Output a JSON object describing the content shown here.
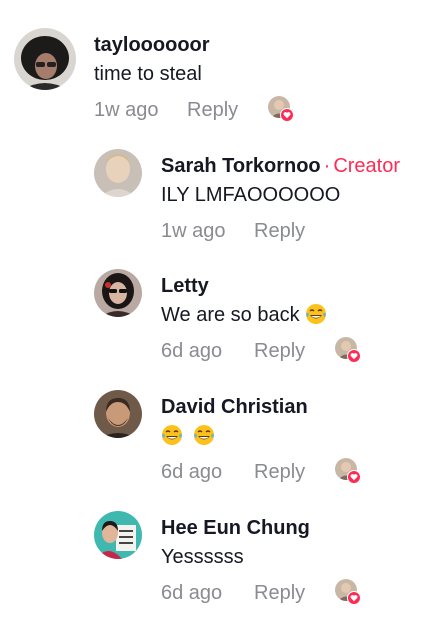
{
  "comments": [
    {
      "username": "tayloooooor",
      "text": "time to steal",
      "time": "1w ago",
      "reply_label": "Reply",
      "creator_tag": "",
      "creator_liked": true,
      "avatar_icon": "avatar-taylor"
    },
    {
      "username": "Sarah Torkornoo",
      "text": "ILY LMFAOOOOOO",
      "time": "1w ago",
      "reply_label": "Reply",
      "creator_tag": "Creator",
      "creator_dot": "·",
      "creator_liked": false,
      "avatar_icon": "avatar-sarah"
    },
    {
      "username": "Letty",
      "text": "We are so back",
      "emojis": [
        "face-with-tears-of-joy"
      ],
      "time": "6d ago",
      "reply_label": "Reply",
      "creator_tag": "",
      "creator_liked": true,
      "avatar_icon": "avatar-letty"
    },
    {
      "username": "David Christian",
      "text": "",
      "emojis": [
        "face-with-tears-of-joy",
        "face-with-tears-of-joy"
      ],
      "time": "6d ago",
      "reply_label": "Reply",
      "creator_tag": "",
      "creator_liked": true,
      "avatar_icon": "avatar-david"
    },
    {
      "username": "Hee Eun Chung",
      "text": "Yessssss",
      "time": "6d ago",
      "reply_label": "Reply",
      "creator_tag": "",
      "creator_liked": true,
      "avatar_icon": "avatar-hee-eun"
    }
  ],
  "colors": {
    "primary_text": "#161823",
    "secondary_text": "#8a8b91",
    "accent": "#fe2c55"
  }
}
